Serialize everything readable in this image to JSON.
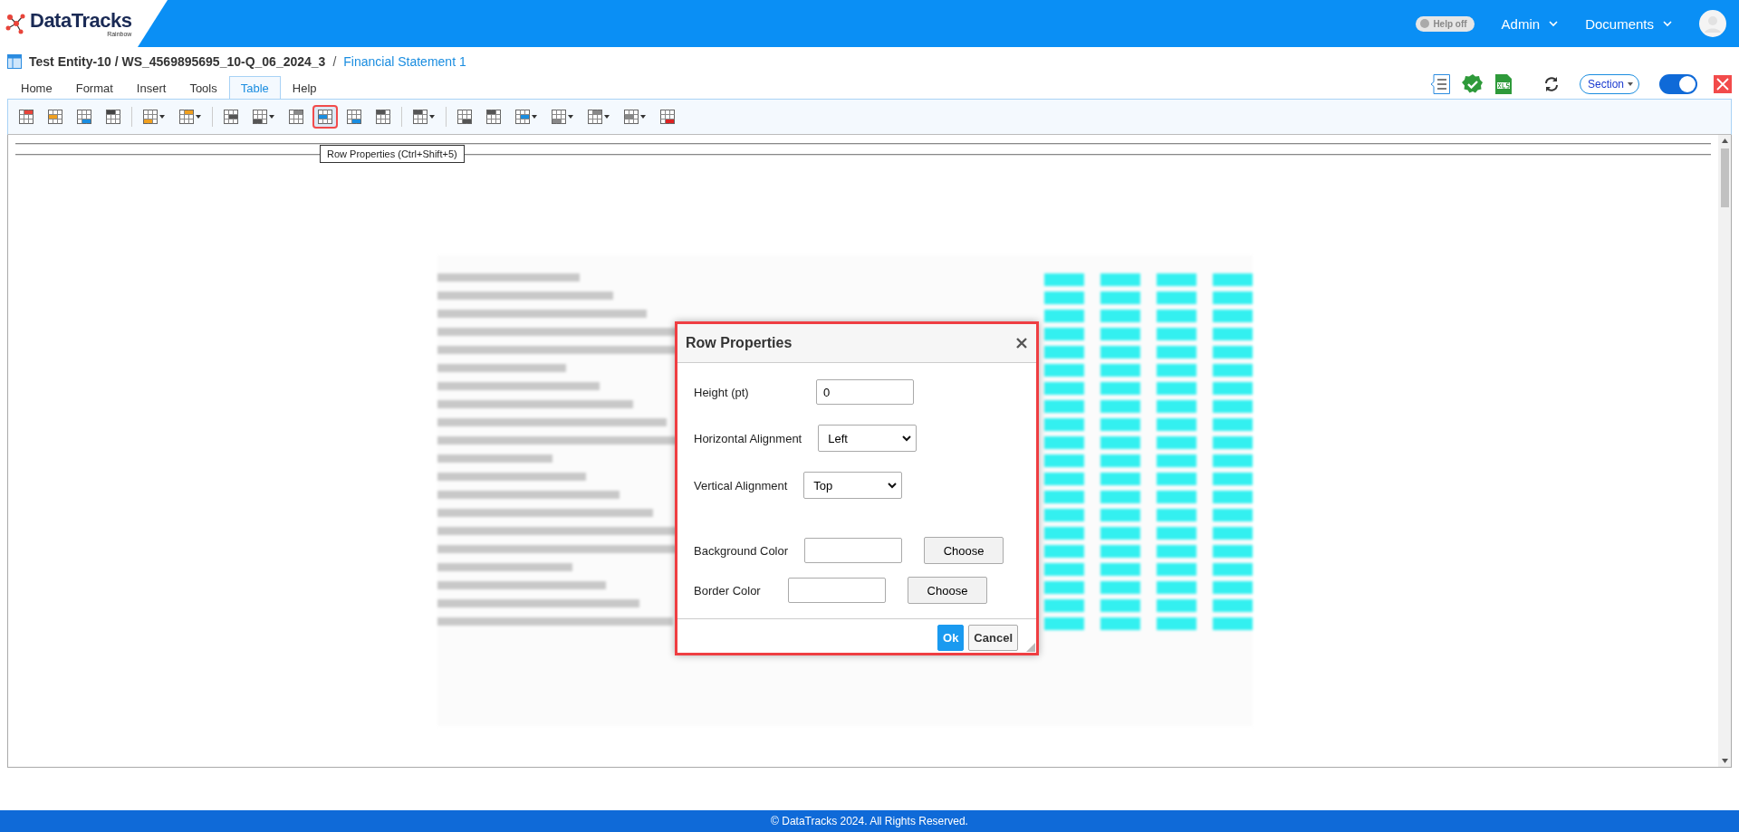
{
  "logo": {
    "name": "DataTracks",
    "tagline": "Rainbow"
  },
  "header": {
    "help_toggle": {
      "label": "Help off",
      "on": false
    },
    "menus": [
      {
        "label": "Admin"
      },
      {
        "label": "Documents"
      }
    ]
  },
  "breadcrumb": {
    "path": "Test Entity-10 / WS_4569895695_10-Q_06_2024_3",
    "separator": "/",
    "current": "Financial Statement 1"
  },
  "tabs": [
    {
      "label": "Home",
      "selected": false
    },
    {
      "label": "Format",
      "selected": false
    },
    {
      "label": "Insert",
      "selected": false
    },
    {
      "label": "Tools",
      "selected": false
    },
    {
      "label": "Table",
      "selected": true
    },
    {
      "label": "Help",
      "selected": false
    }
  ],
  "right_tools": {
    "section_select": "Section",
    "view_toggle": {
      "on": true
    }
  },
  "toolbar": [
    [
      {
        "dropdown": false,
        "highlighted": false
      },
      {
        "dropdown": false,
        "highlighted": false
      },
      {
        "dropdown": false,
        "highlighted": false
      },
      {
        "dropdown": false,
        "highlighted": false
      }
    ],
    [
      {
        "dropdown": true,
        "highlighted": false
      },
      {
        "dropdown": true,
        "highlighted": false
      }
    ],
    [
      {
        "dropdown": false,
        "highlighted": false
      },
      {
        "dropdown": true,
        "highlighted": false
      },
      {
        "dropdown": false,
        "highlighted": false
      },
      {
        "dropdown": false,
        "highlighted": true
      },
      {
        "dropdown": false,
        "highlighted": false
      },
      {
        "dropdown": false,
        "highlighted": false
      }
    ],
    [
      {
        "dropdown": true,
        "highlighted": false
      }
    ],
    [
      {
        "dropdown": false,
        "highlighted": false
      },
      {
        "dropdown": false,
        "highlighted": false
      },
      {
        "dropdown": true,
        "highlighted": false
      },
      {
        "dropdown": true,
        "highlighted": false
      },
      {
        "dropdown": true,
        "highlighted": false
      },
      {
        "dropdown": true,
        "highlighted": false
      },
      {
        "dropdown": false,
        "highlighted": false
      }
    ]
  ],
  "tooltip": "Row Properties (Ctrl+Shift+5)",
  "dialog": {
    "title": "Row Properties",
    "fields": [
      {
        "label": "Height (pt)",
        "kind": "text",
        "value": "0"
      },
      {
        "label": "Horizontal Alignment",
        "kind": "select",
        "value": "Left"
      },
      {
        "label": "Vertical Alignment",
        "kind": "select",
        "value": "Top"
      },
      {
        "label": "Background Color",
        "kind": "color",
        "button": "Choose"
      },
      {
        "label": "Border Color",
        "kind": "color",
        "button": "Choose"
      }
    ],
    "buttons": [
      {
        "label": "Ok",
        "primary": true
      },
      {
        "label": "Cancel",
        "primary": false
      }
    ]
  },
  "footer": "© DataTracks 2024. All Rights Reserved."
}
